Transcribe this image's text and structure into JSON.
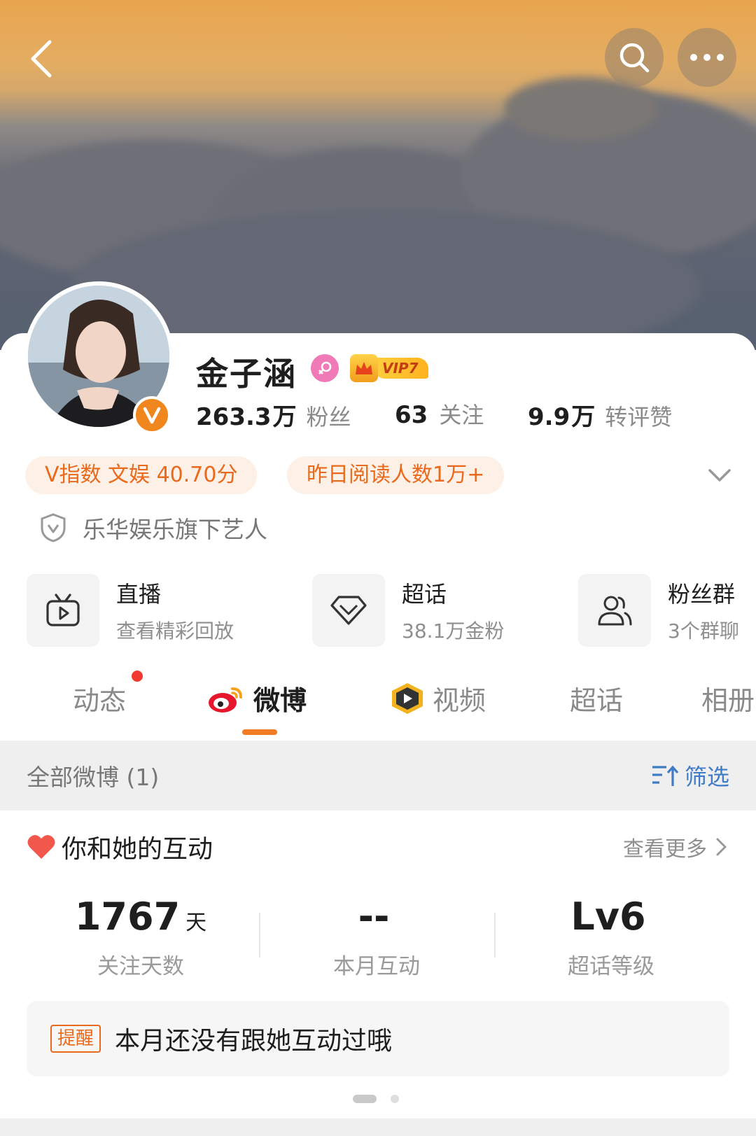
{
  "header": {
    "back_icon": "chevron-left-icon",
    "search_icon": "search-icon",
    "more_icon": "more-dots-icon"
  },
  "profile": {
    "name": "金子涵",
    "gender_icon": "female-icon",
    "vip_label": "VIP7",
    "verified_icon": "verified-v-icon",
    "stats": [
      {
        "value": "263.3",
        "unit": "万",
        "label": "粉丝"
      },
      {
        "value": "63",
        "unit": "",
        "label": "关注"
      },
      {
        "value": "9.9",
        "unit": "万",
        "label": "转评赞"
      }
    ],
    "pills": [
      "V指数 文娱 40.70分",
      "昨日阅读人数1万+"
    ],
    "org": "乐华娱乐旗下艺人"
  },
  "tiles": [
    {
      "title": "直播",
      "sub": "查看精彩回放",
      "icon": "tv-icon"
    },
    {
      "title": "超话",
      "sub": "38.1万金粉",
      "icon": "diamond-icon"
    },
    {
      "title": "粉丝群",
      "sub": "3个群聊",
      "icon": "group-icon"
    }
  ],
  "tabs": [
    {
      "label": "动态",
      "active": false
    },
    {
      "label": "微博",
      "active": true
    },
    {
      "label": "视频",
      "active": false
    },
    {
      "label": "超话",
      "active": false
    },
    {
      "label": "相册",
      "active": false
    }
  ],
  "filter": {
    "left": "全部微博 (1)",
    "right": "筛选"
  },
  "interaction": {
    "title": "你和她的互动",
    "more": "查看更多",
    "metrics": [
      {
        "value": "1767",
        "unit": "天",
        "label": "关注天数"
      },
      {
        "value": "--",
        "unit": "",
        "label": "本月互动"
      },
      {
        "value": "Lv6",
        "unit": "",
        "label": "超话等级"
      }
    ],
    "reminder_tag": "提醒",
    "reminder_text": "本月还没有跟她互动过哦"
  },
  "colors": {
    "accent": "#f27b24",
    "link": "#3f7bc7",
    "pill_bg": "#fdf0e6",
    "pill_text": "#e96a1c"
  }
}
